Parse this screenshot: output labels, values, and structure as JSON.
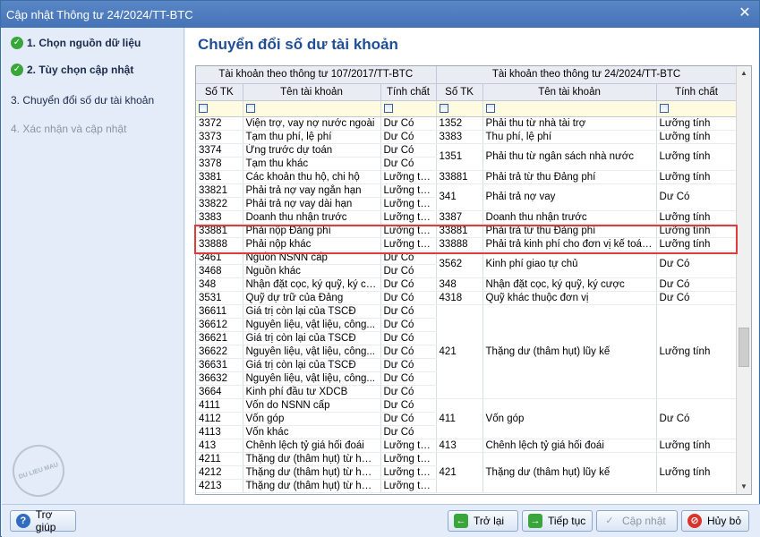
{
  "window": {
    "title": "Cập nhật Thông tư 24/2024/TT-BTC"
  },
  "sidebar": {
    "steps": [
      {
        "label": "1. Chọn nguồn dữ liệu",
        "state": "done"
      },
      {
        "label": "2. Tùy chọn cập nhật",
        "state": "done"
      },
      {
        "label": "3. Chuyển đổi số dư tài khoản",
        "state": "current"
      },
      {
        "label": "4. Xác nhận và cập nhật",
        "state": "pending"
      }
    ],
    "stamp": "DU LIEU MAU"
  },
  "main": {
    "heading": "Chuyển đổi số dư tài khoản"
  },
  "grid": {
    "group_left": "Tài khoản theo thông tư 107/2017/TT-BTC",
    "group_right": "Tài khoản theo thông tư 24/2024/TT-BTC",
    "columns": [
      "Số TK",
      "Tên tài khoản",
      "Tính chất",
      "Số TK",
      "Tên tài khoản",
      "Tính chất"
    ],
    "left_rows": [
      [
        "3372",
        "Viện trợ, vay nợ nước ngoài",
        "Dư Có"
      ],
      [
        "3373",
        "Tạm thu phí, lệ phí",
        "Dư Có"
      ],
      [
        "3374",
        "Ứng trước dự toán",
        "Dư Có"
      ],
      [
        "3378",
        "Tạm thu khác",
        "Dư Có"
      ],
      [
        "3381",
        "Các khoản thu hộ, chi hộ",
        "Lưỡng tính"
      ],
      [
        "33821",
        "Phải trả nợ vay ngắn hạn",
        "Lưỡng tính"
      ],
      [
        "33822",
        "Phải trả nợ vay dài hạn",
        "Lưỡng tính"
      ],
      [
        "3383",
        "Doanh thu nhận trước",
        "Lưỡng tính"
      ],
      [
        "33881",
        "Phải nộp Đảng phí",
        "Lưỡng tính"
      ],
      [
        "33888",
        "Phải nộp khác",
        "Lưỡng tính"
      ],
      [
        "3461",
        "Nguồn NSNN cấp",
        "Dư Có"
      ],
      [
        "3468",
        "Nguồn khác",
        "Dư Có"
      ],
      [
        "348",
        "Nhận đặt cọc, ký quỹ, ký cư...",
        "Dư Có"
      ],
      [
        "3531",
        "Quỹ dự trữ của Đảng",
        "Dư Có"
      ],
      [
        "36611",
        "Giá trị còn lại của TSCĐ",
        "Dư Có"
      ],
      [
        "36612",
        "Nguyên liệu, vật liệu, công...",
        "Dư Có"
      ],
      [
        "36621",
        "Giá trị còn lại của TSCĐ",
        "Dư Có"
      ],
      [
        "36622",
        "Nguyên liệu, vật liệu, công...",
        "Dư Có"
      ],
      [
        "36631",
        "Giá trị còn lại của TSCĐ",
        "Dư Có"
      ],
      [
        "36632",
        "Nguyên liệu, vật liệu, công...",
        "Dư Có"
      ],
      [
        "3664",
        "Kinh phí đầu tư XDCB",
        "Dư Có"
      ],
      [
        "4111",
        "Vốn do NSNN cấp",
        "Dư Có"
      ],
      [
        "4112",
        "Vốn góp",
        "Dư Có"
      ],
      [
        "4113",
        "Vốn khác",
        "Dư Có"
      ],
      [
        "413",
        "Chênh lệch tỷ giá hối đoái",
        "Lưỡng tính"
      ],
      [
        "4211",
        "Thặng dư (thâm hụt) từ hoat...",
        "Lưỡng tính"
      ],
      [
        "4212",
        "Thặng dư (thâm hụt) từ hoat...",
        "Lưỡng tính"
      ],
      [
        "4213",
        "Thặng dư (thâm hụt) từ hoat...",
        "Lưỡng tính"
      ]
    ],
    "right_groups": [
      {
        "span": 1,
        "code": "1352",
        "name": "Phải thu từ nhà tài trợ",
        "nature": "Lưỡng tính"
      },
      {
        "span": 1,
        "code": "3383",
        "name": "Thu phí, lệ phí",
        "nature": "Lưỡng tính"
      },
      {
        "span": 2,
        "code": "1351",
        "name": "Phải thu từ ngân sách nhà nước",
        "nature": "Lưỡng tính"
      },
      {
        "span": 1,
        "code": "33881",
        "name": "Phải trả từ thu Đảng phí",
        "nature": "Lưỡng tính"
      },
      {
        "span": 2,
        "code": "341",
        "name": "Phải trả nợ vay",
        "nature": "Dư Có"
      },
      {
        "span": 1,
        "code": "3387",
        "name": "Doanh thu nhận trước",
        "nature": "Lưỡng tính"
      },
      {
        "span": 1,
        "code": "33881",
        "name": "Phải trả từ thu Đảng phí",
        "nature": "Lưỡng tính"
      },
      {
        "span": 1,
        "code": "33888",
        "name": "Phải trả kinh phí cho đơn vị kế toán...",
        "nature": "Lưỡng tính"
      },
      {
        "span": 2,
        "code": "3562",
        "name": "Kinh phí giao tự chủ",
        "nature": "Dư Có"
      },
      {
        "span": 1,
        "code": "348",
        "name": "Nhận đặt cọc, ký quỹ, ký cược",
        "nature": "Dư Có"
      },
      {
        "span": 1,
        "code": "4318",
        "name": "Quỹ khác thuộc đơn vị",
        "nature": "Dư Có"
      },
      {
        "span": 7,
        "code": "421",
        "name": "Thặng dư (thâm hụt) lũy kế",
        "nature": "Lưỡng tính"
      },
      {
        "span": 3,
        "code": "411",
        "name": "Vốn góp",
        "nature": "Dư Có"
      },
      {
        "span": 1,
        "code": "413",
        "name": "Chênh lệch tỷ giá hối đoái",
        "nature": "Lưỡng tính"
      },
      {
        "span": 3,
        "code": "421",
        "name": "Thặng dư (thâm hụt) lũy kế",
        "nature": "Lưỡng tính"
      }
    ]
  },
  "footer": {
    "help": "Trợ giúp",
    "back": "Trở lại",
    "next": "Tiếp tục",
    "update": "Cập nhật",
    "cancel": "Hủy bỏ"
  }
}
